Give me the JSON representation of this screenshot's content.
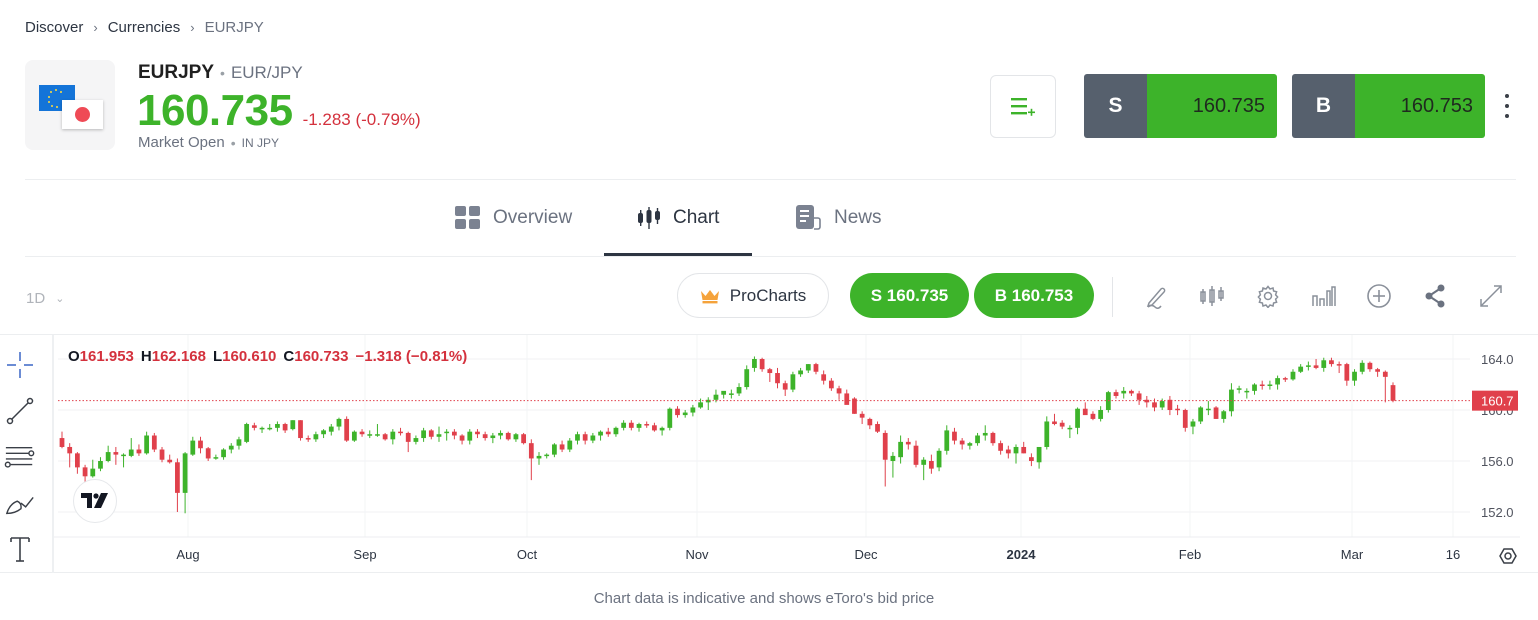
{
  "breadcrumb": [
    "Discover",
    "Currencies",
    "EURJPY"
  ],
  "instrument": {
    "symbol": "EURJPY",
    "name": "EUR/JPY",
    "price": "160.735",
    "change": "-1.283 (-0.79%)",
    "market_status": "Market Open",
    "currency_note": "IN JPY"
  },
  "trade": {
    "sell_label": "S",
    "sell_price": "160.735",
    "buy_label": "B",
    "buy_price": "160.753"
  },
  "tabs": [
    {
      "label": "Overview",
      "icon": "grid-icon"
    },
    {
      "label": "Chart",
      "icon": "candlestick-icon",
      "active": true
    },
    {
      "label": "News",
      "icon": "news-icon"
    }
  ],
  "toolbar": {
    "timeframe": "1D",
    "procharts_label": "ProCharts",
    "sell_pill": "S 160.735",
    "buy_pill": "B 160.753",
    "icons": [
      "pencil-icon",
      "candles-icon",
      "settings-icon",
      "indicators-icon",
      "add-icon",
      "share-icon",
      "expand-icon"
    ]
  },
  "left_tools": [
    "crosshair-icon",
    "trend-line-icon",
    "fib-retracement-icon",
    "brush-icon",
    "text-icon"
  ],
  "ohlc": {
    "o": "161.953",
    "h": "162.168",
    "l": "160.610",
    "c": "160.733",
    "chg": "−1.318 (−0.81%)"
  },
  "footnote": "Chart data is indicative and shows eToro's bid price",
  "colors": {
    "up": "#3db32a",
    "down": "#e0404b",
    "accent_green": "#3db32a",
    "price_tag": "#e0404b"
  },
  "chart_data": {
    "type": "candlestick",
    "title": "EURJPY 1D",
    "x_tick_labels": [
      "Aug",
      "Sep",
      "Oct",
      "Nov",
      "Dec",
      "2024",
      "Feb",
      "Mar",
      "16"
    ],
    "y_tick_labels": [
      "164.0",
      "160.0",
      "156.0",
      "152.0"
    ],
    "ylim": [
      151.0,
      165.2
    ],
    "last_price_label": "160.7",
    "last_price": 160.733,
    "grid": true,
    "candles": [
      [
        157.8,
        158.3,
        157.0,
        157.1
      ],
      [
        157.1,
        157.4,
        155.5,
        156.6
      ],
      [
        156.6,
        156.7,
        155.0,
        155.5
      ],
      [
        155.5,
        155.7,
        154.3,
        154.8
      ],
      [
        154.8,
        156.1,
        154.7,
        155.4
      ],
      [
        155.4,
        156.3,
        155.2,
        156.0
      ],
      [
        156.0,
        157.2,
        155.9,
        156.7
      ],
      [
        156.7,
        157.1,
        155.7,
        156.5
      ],
      [
        156.4,
        156.6,
        155.5,
        156.5
      ],
      [
        156.4,
        157.8,
        156.3,
        156.9
      ],
      [
        156.9,
        157.3,
        156.4,
        156.6
      ],
      [
        156.6,
        158.3,
        156.5,
        158.0
      ],
      [
        158.0,
        158.2,
        156.7,
        156.9
      ],
      [
        156.9,
        157.1,
        155.9,
        156.1
      ],
      [
        156.1,
        156.5,
        155.8,
        155.9
      ],
      [
        155.9,
        156.2,
        152.0,
        153.5
      ],
      [
        153.5,
        156.7,
        151.9,
        156.6
      ],
      [
        156.5,
        157.9,
        156.4,
        157.6
      ],
      [
        157.6,
        157.9,
        156.6,
        157.0
      ],
      [
        157.0,
        157.1,
        156.0,
        156.2
      ],
      [
        156.2,
        156.5,
        156.1,
        156.3
      ],
      [
        156.3,
        157.0,
        156.1,
        156.9
      ],
      [
        156.9,
        157.4,
        156.6,
        157.2
      ],
      [
        157.2,
        157.9,
        156.9,
        157.7
      ],
      [
        157.5,
        159.0,
        157.4,
        158.9
      ],
      [
        158.8,
        159.0,
        158.4,
        158.6
      ],
      [
        158.6,
        158.7,
        158.2,
        158.6
      ],
      [
        158.6,
        158.9,
        158.4,
        158.6
      ],
      [
        158.6,
        159.1,
        158.3,
        158.9
      ],
      [
        158.9,
        159.0,
        158.2,
        158.4
      ],
      [
        158.5,
        159.2,
        158.4,
        159.2
      ],
      [
        159.2,
        159.2,
        157.6,
        157.8
      ],
      [
        157.8,
        158.0,
        157.5,
        157.7
      ],
      [
        157.7,
        158.3,
        157.5,
        158.1
      ],
      [
        158.1,
        158.5,
        157.8,
        158.4
      ],
      [
        158.3,
        158.9,
        158.0,
        158.7
      ],
      [
        158.7,
        159.4,
        158.4,
        159.3
      ],
      [
        159.3,
        159.5,
        157.5,
        157.6
      ],
      [
        157.6,
        158.4,
        157.5,
        158.3
      ],
      [
        158.3,
        158.5,
        157.9,
        158.1
      ],
      [
        158.1,
        158.4,
        157.8,
        158.1
      ],
      [
        158.0,
        158.9,
        157.9,
        158.1
      ],
      [
        158.1,
        158.2,
        157.6,
        157.7
      ],
      [
        157.7,
        158.5,
        157.3,
        158.3
      ],
      [
        158.3,
        158.6,
        158.0,
        158.2
      ],
      [
        158.2,
        158.3,
        156.7,
        157.5
      ],
      [
        157.5,
        158.0,
        157.3,
        157.8
      ],
      [
        157.8,
        158.6,
        157.5,
        158.4
      ],
      [
        158.4,
        158.5,
        157.7,
        157.9
      ],
      [
        157.9,
        158.7,
        157.5,
        158.1
      ],
      [
        158.2,
        158.5,
        157.6,
        158.3
      ],
      [
        158.3,
        158.5,
        157.7,
        158.0
      ],
      [
        158.0,
        158.1,
        157.3,
        157.6
      ],
      [
        157.6,
        158.5,
        157.3,
        158.3
      ],
      [
        158.3,
        158.5,
        157.8,
        158.1
      ],
      [
        158.1,
        158.3,
        157.6,
        157.8
      ],
      [
        157.8,
        158.2,
        157.4,
        158.0
      ],
      [
        158.0,
        158.4,
        157.7,
        158.2
      ],
      [
        158.2,
        158.3,
        157.6,
        157.7
      ],
      [
        157.7,
        158.2,
        157.5,
        158.1
      ],
      [
        158.1,
        158.2,
        157.3,
        157.4
      ],
      [
        157.4,
        157.7,
        154.5,
        156.2
      ],
      [
        156.2,
        156.7,
        155.7,
        156.4
      ],
      [
        156.4,
        156.6,
        156.2,
        156.5
      ],
      [
        156.5,
        157.4,
        156.3,
        157.3
      ],
      [
        157.3,
        157.6,
        156.7,
        156.9
      ],
      [
        156.9,
        157.8,
        156.7,
        157.6
      ],
      [
        157.6,
        158.3,
        157.3,
        158.1
      ],
      [
        158.1,
        158.3,
        157.3,
        157.6
      ],
      [
        157.6,
        158.2,
        157.4,
        158.0
      ],
      [
        158.0,
        158.4,
        157.6,
        158.3
      ],
      [
        158.3,
        158.6,
        157.9,
        158.1
      ],
      [
        158.1,
        158.7,
        157.9,
        158.6
      ],
      [
        158.6,
        159.2,
        158.4,
        159.0
      ],
      [
        159.0,
        159.2,
        158.4,
        158.6
      ],
      [
        158.6,
        159.0,
        158.3,
        158.9
      ],
      [
        158.9,
        159.1,
        158.6,
        158.8
      ],
      [
        158.8,
        159.0,
        158.3,
        158.4
      ],
      [
        158.4,
        158.7,
        158.0,
        158.6
      ],
      [
        158.6,
        160.2,
        158.4,
        160.1
      ],
      [
        160.1,
        160.3,
        159.4,
        159.6
      ],
      [
        159.6,
        160.0,
        159.4,
        159.8
      ],
      [
        159.8,
        160.4,
        159.5,
        160.2
      ],
      [
        160.2,
        160.9,
        160.1,
        160.6
      ],
      [
        160.6,
        161.0,
        160.0,
        160.8
      ],
      [
        160.8,
        161.6,
        160.6,
        161.2
      ],
      [
        161.2,
        161.4,
        160.9,
        161.5
      ],
      [
        161.2,
        161.6,
        160.9,
        161.3
      ],
      [
        161.3,
        162.1,
        161.1,
        161.8
      ],
      [
        161.8,
        163.5,
        161.6,
        163.2
      ],
      [
        163.3,
        164.2,
        163.0,
        164.0
      ],
      [
        164.0,
        164.1,
        163.0,
        163.2
      ],
      [
        163.2,
        163.3,
        162.2,
        162.9
      ],
      [
        162.9,
        163.3,
        161.7,
        162.1
      ],
      [
        162.1,
        162.3,
        161.1,
        161.6
      ],
      [
        161.6,
        163.0,
        161.4,
        162.8
      ],
      [
        162.8,
        163.3,
        162.6,
        163.1
      ],
      [
        163.1,
        163.6,
        162.9,
        163.6
      ],
      [
        163.6,
        163.7,
        162.8,
        163.0
      ],
      [
        162.8,
        163.1,
        162.0,
        162.3
      ],
      [
        162.3,
        162.5,
        161.5,
        161.7
      ],
      [
        161.7,
        161.9,
        160.8,
        161.3
      ],
      [
        161.3,
        161.6,
        160.5,
        160.4
      ],
      [
        160.9,
        161.0,
        159.7,
        159.7
      ],
      [
        159.7,
        159.9,
        158.9,
        159.4
      ],
      [
        159.3,
        159.4,
        158.5,
        158.8
      ],
      [
        158.9,
        159.1,
        158.2,
        158.3
      ],
      [
        158.2,
        158.4,
        154.0,
        156.1
      ],
      [
        156.0,
        156.7,
        154.7,
        156.4
      ],
      [
        156.3,
        158.0,
        155.8,
        157.5
      ],
      [
        157.5,
        157.8,
        156.9,
        157.3
      ],
      [
        157.2,
        157.6,
        155.5,
        155.7
      ],
      [
        155.7,
        156.3,
        154.5,
        156.1
      ],
      [
        156.0,
        156.5,
        155.0,
        155.4
      ],
      [
        155.5,
        157.0,
        155.2,
        156.8
      ],
      [
        156.8,
        158.8,
        156.5,
        158.4
      ],
      [
        158.3,
        158.6,
        157.3,
        157.6
      ],
      [
        157.6,
        157.8,
        156.9,
        157.3
      ],
      [
        157.2,
        157.5,
        156.9,
        157.4
      ],
      [
        157.4,
        158.2,
        157.2,
        158.0
      ],
      [
        158.0,
        158.8,
        157.6,
        158.2
      ],
      [
        158.2,
        158.3,
        157.2,
        157.4
      ],
      [
        157.4,
        157.6,
        156.5,
        156.8
      ],
      [
        156.9,
        157.2,
        156.2,
        156.6
      ],
      [
        156.6,
        157.3,
        155.8,
        157.1
      ],
      [
        157.1,
        157.5,
        156.6,
        156.6
      ],
      [
        156.3,
        156.6,
        155.6,
        156.0
      ],
      [
        155.9,
        157.0,
        155.4,
        157.1
      ],
      [
        157.1,
        159.5,
        156.9,
        159.1
      ],
      [
        159.1,
        159.7,
        158.8,
        158.9
      ],
      [
        159.0,
        159.2,
        158.5,
        158.7
      ],
      [
        158.6,
        158.8,
        157.8,
        158.6
      ],
      [
        158.6,
        160.2,
        158.1,
        160.1
      ],
      [
        160.1,
        160.6,
        159.8,
        159.6
      ],
      [
        159.7,
        159.9,
        159.2,
        159.3
      ],
      [
        159.3,
        160.3,
        159.1,
        160.0
      ],
      [
        160.0,
        161.5,
        159.8,
        161.4
      ],
      [
        161.4,
        161.6,
        160.9,
        161.1
      ],
      [
        161.3,
        161.8,
        160.9,
        161.5
      ],
      [
        161.5,
        161.6,
        161.1,
        161.3
      ],
      [
        161.3,
        161.5,
        160.4,
        160.8
      ],
      [
        160.8,
        161.1,
        160.2,
        160.6
      ],
      [
        160.6,
        160.9,
        159.9,
        160.2
      ],
      [
        160.2,
        160.9,
        160.0,
        160.7
      ],
      [
        160.8,
        161.1,
        159.6,
        160.0
      ],
      [
        160.1,
        160.4,
        159.6,
        160.0
      ],
      [
        160.0,
        160.1,
        158.3,
        158.6
      ],
      [
        158.7,
        159.3,
        158.1,
        159.1
      ],
      [
        159.1,
        160.3,
        158.9,
        160.2
      ],
      [
        160.0,
        160.7,
        159.6,
        160.1
      ],
      [
        160.2,
        160.3,
        159.3,
        159.3
      ],
      [
        159.3,
        160.0,
        159.0,
        159.9
      ],
      [
        159.9,
        162.1,
        159.5,
        161.6
      ],
      [
        161.6,
        161.9,
        161.3,
        161.7
      ],
      [
        161.4,
        161.7,
        160.9,
        161.5
      ],
      [
        161.5,
        162.1,
        161.2,
        162.0
      ],
      [
        162.0,
        162.3,
        161.6,
        161.9
      ],
      [
        161.9,
        162.3,
        161.6,
        162.0
      ],
      [
        162.0,
        162.7,
        161.6,
        162.5
      ],
      [
        162.5,
        162.6,
        162.2,
        162.4
      ],
      [
        162.4,
        163.2,
        162.3,
        163.0
      ],
      [
        163.0,
        163.6,
        162.9,
        163.4
      ],
      [
        163.4,
        163.8,
        163.1,
        163.5
      ],
      [
        163.5,
        164.0,
        163.2,
        163.3
      ],
      [
        163.3,
        164.1,
        163.0,
        163.9
      ],
      [
        163.9,
        164.1,
        163.4,
        163.6
      ],
      [
        163.6,
        163.8,
        162.9,
        163.5
      ],
      [
        163.6,
        163.7,
        161.9,
        162.3
      ],
      [
        162.3,
        163.2,
        161.9,
        163.0
      ],
      [
        163.0,
        163.9,
        162.8,
        163.7
      ],
      [
        163.7,
        163.8,
        163.0,
        163.2
      ],
      [
        163.2,
        163.3,
        162.6,
        163.0
      ],
      [
        163.0,
        163.1,
        160.6,
        162.6
      ],
      [
        161.95,
        162.17,
        160.61,
        160.73
      ]
    ]
  }
}
